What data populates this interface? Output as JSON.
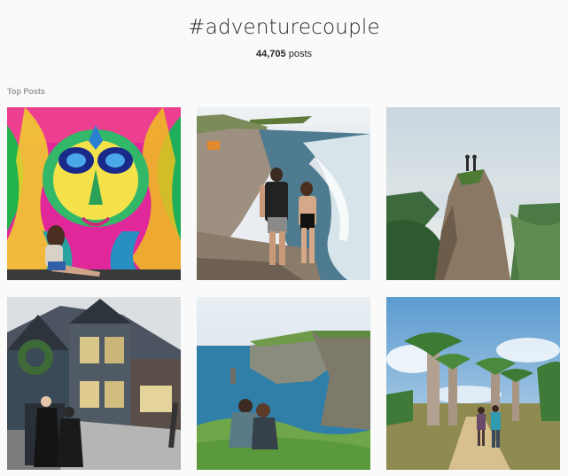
{
  "hashtag": {
    "title": "#adventurecouple"
  },
  "stats": {
    "count": "44,705",
    "unit": "posts"
  },
  "section": {
    "label": "Top Posts"
  },
  "posts": [
    {
      "subject": "graffiti-mural-photo"
    },
    {
      "subject": "couple-coastline-photo"
    },
    {
      "subject": "mountain-peak-photo"
    },
    {
      "subject": "wizard-street-photo"
    },
    {
      "subject": "sea-cliffs-photo"
    },
    {
      "subject": "baobab-avenue-photo"
    }
  ]
}
